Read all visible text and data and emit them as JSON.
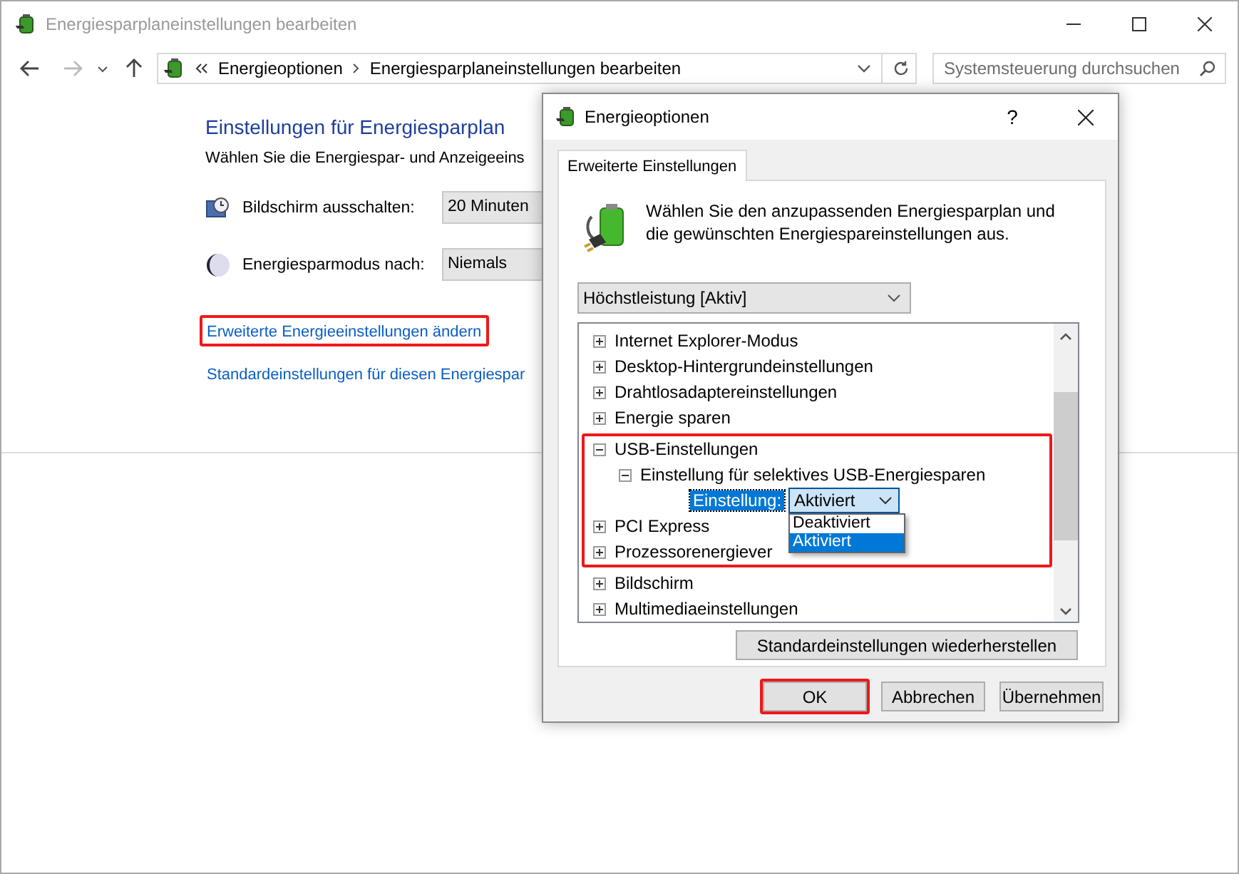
{
  "window": {
    "title": "Energiesparplaneinstellungen bearbeiten"
  },
  "address_bar": {
    "path": [
      "Energieoptionen",
      "Energiesparplaneinstellungen bearbeiten"
    ],
    "search": {
      "placeholder": "Systemsteuerung durchsuchen"
    }
  },
  "content": {
    "heading": "Einstellungen für Energiesparplan",
    "subtitle": "Wählen Sie die Energiespar- und Anzeigeeins",
    "settings": [
      {
        "kind": "display",
        "label": "Bildschirm ausschalten:",
        "value": "20 Minuten"
      },
      {
        "kind": "sleep",
        "label": "Energiesparmodus nach:",
        "value": "Niemals"
      }
    ],
    "links": [
      {
        "text": "Erweiterte Energieeinstellungen ändern",
        "highlighted": true
      },
      {
        "text": "Standardeinstellungen für diesen Energiespar",
        "highlighted": false
      }
    ]
  },
  "dialog": {
    "title": "Energieoptionen",
    "help": "?",
    "tabs": [
      {
        "label": "Erweiterte Einstellungen",
        "selected": true
      }
    ],
    "description": "Wählen Sie den anzupassenden Energiesparplan und die gewünschten Energiespareinstellungen aus.",
    "plan": "Höchstleistung [Aktiv]",
    "tree": [
      {
        "label": "Internet Explorer-Modus",
        "expanded": false,
        "highlighted": false
      },
      {
        "label": "Desktop-Hintergrundeinstellungen",
        "expanded": false,
        "highlighted": false
      },
      {
        "label": "Drahtlosadaptereinstellungen",
        "expanded": false,
        "highlighted": false
      },
      {
        "label": "Energie sparen",
        "expanded": false,
        "highlighted": false
      },
      {
        "label": "USB-Einstellungen",
        "expanded": true,
        "highlighted": true,
        "children": [
          {
            "label": "Einstellung für selektives USB-Energiesparen",
            "expanded": true,
            "children": [
              {
                "kind": "setting",
                "label": "Einstellung:",
                "value": "Aktiviert",
                "options": [
                  {
                    "label": "Deaktiviert",
                    "selected": false
                  },
                  {
                    "label": "Aktiviert",
                    "selected": true
                  }
                ]
              }
            ]
          }
        ]
      },
      {
        "label": "PCI Express",
        "expanded": false,
        "highlighted": true
      },
      {
        "label": "Prozessorenergiever",
        "expanded": false,
        "highlighted": true
      },
      {
        "label": "Bildschirm",
        "expanded": false,
        "highlighted": false
      },
      {
        "label": "Multimediaeinstellungen",
        "expanded": false,
        "highlighted": false
      }
    ],
    "restore_button": "Standardeinstellungen wiederherstellen",
    "buttons": [
      {
        "label": "OK",
        "highlighted": true
      },
      {
        "label": "Abbrechen",
        "highlighted": false
      },
      {
        "label": "Übernehmen",
        "highlighted": false
      }
    ]
  }
}
